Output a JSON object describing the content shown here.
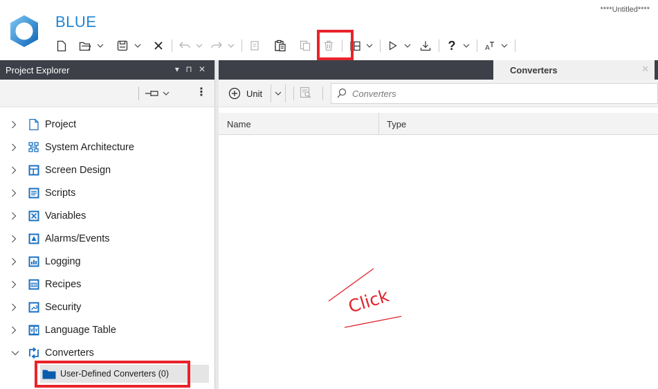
{
  "app": {
    "title": "BLUE",
    "document_title": "****Untitled****"
  },
  "toolbar": {
    "buttons": [
      {
        "name": "new-button",
        "icon": "new-document-icon"
      },
      {
        "name": "open-button",
        "icon": "open-folder-icon"
      },
      {
        "name": "save-button",
        "icon": "save-icon"
      },
      {
        "name": "close-button",
        "icon": "close-icon"
      },
      {
        "name": "undo-button",
        "icon": "undo-icon"
      },
      {
        "name": "redo-button",
        "icon": "redo-icon"
      },
      {
        "name": "copy-button",
        "icon": "copy-icon"
      },
      {
        "name": "paste-button",
        "icon": "paste-icon"
      },
      {
        "name": "duplicate-button",
        "icon": "duplicate-icon"
      },
      {
        "name": "delete-button",
        "icon": "trash-icon"
      },
      {
        "name": "layout-button",
        "icon": "layout-icon"
      },
      {
        "name": "run-button",
        "icon": "play-icon"
      },
      {
        "name": "download-button",
        "icon": "download-icon"
      },
      {
        "name": "help-button",
        "icon": "help-icon",
        "label": "?"
      },
      {
        "name": "font-button",
        "icon": "text-size-icon"
      }
    ],
    "highlighted": "paste-button",
    "highlight_color": "#e8232b"
  },
  "left_panel": {
    "title": "Project Explorer",
    "header_controls": "▾ ⊓ ✕",
    "tree": [
      {
        "label": "Project",
        "icon": "project-icon",
        "expanded": false
      },
      {
        "label": "System Architecture",
        "icon": "system-architecture-icon",
        "expanded": false
      },
      {
        "label": "Screen Design",
        "icon": "screen-design-icon",
        "expanded": false
      },
      {
        "label": "Scripts",
        "icon": "scripts-icon",
        "expanded": false
      },
      {
        "label": "Variables",
        "icon": "variables-icon",
        "expanded": false
      },
      {
        "label": "Alarms/Events",
        "icon": "alarms-icon",
        "expanded": false
      },
      {
        "label": "Logging",
        "icon": "logging-icon",
        "expanded": false
      },
      {
        "label": "Recipes",
        "icon": "recipes-icon",
        "expanded": false
      },
      {
        "label": "Security",
        "icon": "security-icon",
        "expanded": false
      },
      {
        "label": "Language Table",
        "icon": "language-table-icon",
        "expanded": false
      },
      {
        "label": "Converters",
        "icon": "converters-icon",
        "expanded": true
      }
    ],
    "selected_child": {
      "label": "User-Defined Converters (0)",
      "icon": "folder-icon"
    }
  },
  "right_panel": {
    "tab_label": "Converters",
    "toolbar": {
      "add_label": "Unit",
      "search_placeholder": "Converters"
    },
    "grid": {
      "columns": [
        "Name",
        "Type"
      ],
      "rows": []
    }
  },
  "annotation": {
    "text": "Click",
    "color": "#e2232b"
  },
  "colors": {
    "accent": "#1e86d6",
    "header_dark": "#3d4048",
    "highlight": "#e8232b"
  }
}
